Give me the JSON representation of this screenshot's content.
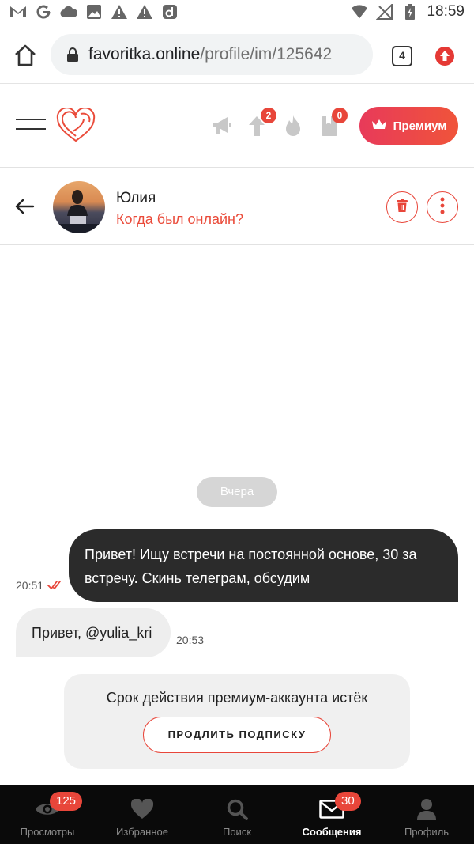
{
  "status_bar": {
    "time": "18:59",
    "left_icons": [
      "gmail-icon",
      "google-icon",
      "cloud-icon",
      "image-icon",
      "warning-icon",
      "warning-icon",
      "d-app-icon"
    ],
    "right_icons": [
      "wifi-icon",
      "no-signal-icon",
      "battery-charging-icon"
    ]
  },
  "browser": {
    "url_host": "favoritka.online",
    "url_path": "/profile/im/125642",
    "tabs_count": "4"
  },
  "site_header": {
    "badges": {
      "up": "2",
      "bookmark": "0"
    },
    "premium_label": "Премиум",
    "accent_color": "#e8463a"
  },
  "chat_header": {
    "contact_name": "Юлия",
    "status_link": "Когда был онлайн?"
  },
  "chat": {
    "date_divider": "Вчера",
    "messages": [
      {
        "direction": "out",
        "text": "Привет! Ищу встречи на постоянной основе, 30 за встречу. Скинь телеграм, обсудим",
        "time": "20:51",
        "read": true
      },
      {
        "direction": "in",
        "text": "Привет, @yulia_kri",
        "time": "20:53"
      }
    ],
    "notice": {
      "text": "Срок действия премиум-аккаунта истёк",
      "button_label": "ПРОДЛИТЬ ПОДПИСКУ"
    }
  },
  "bottom_nav": {
    "items": [
      {
        "label": "Просмотры",
        "icon": "eye-icon",
        "badge": "125"
      },
      {
        "label": "Избранное",
        "icon": "heart-icon",
        "badge": ""
      },
      {
        "label": "Поиск",
        "icon": "search-icon",
        "badge": ""
      },
      {
        "label": "Сообщения",
        "icon": "envelope-icon",
        "badge": "30",
        "active": true
      },
      {
        "label": "Профиль",
        "icon": "user-icon",
        "badge": ""
      }
    ]
  }
}
